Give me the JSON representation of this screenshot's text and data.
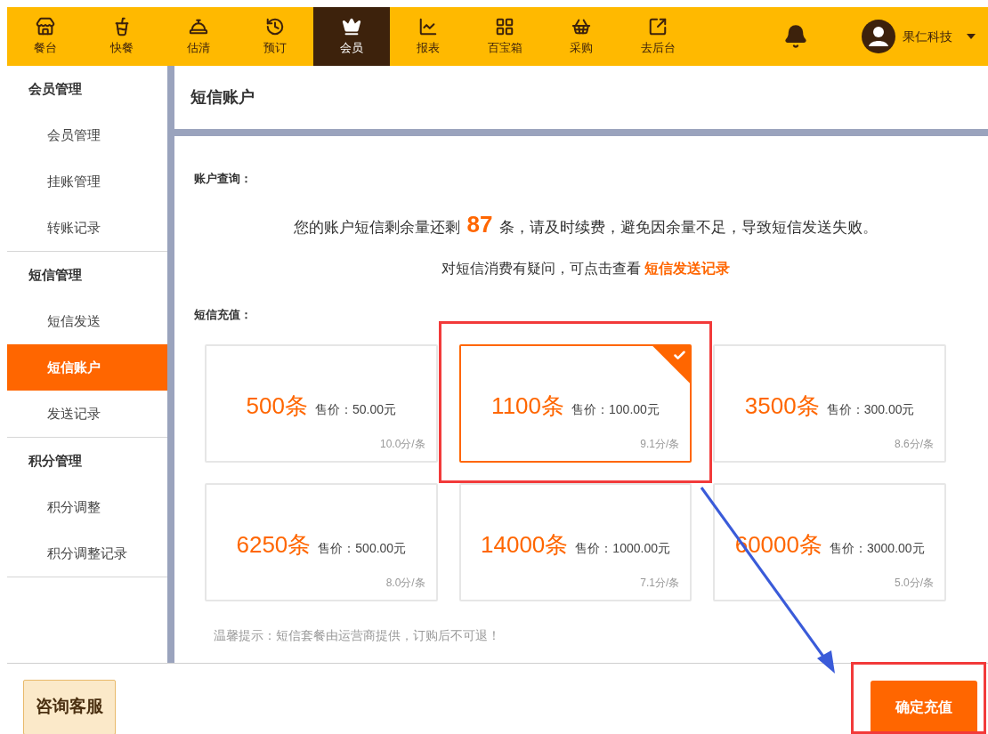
{
  "nav": {
    "items": [
      {
        "label": "餐台",
        "selected": false
      },
      {
        "label": "快餐",
        "selected": false
      },
      {
        "label": "估清",
        "selected": false
      },
      {
        "label": "预订",
        "selected": false
      },
      {
        "label": "会员",
        "selected": true
      },
      {
        "label": "报表",
        "selected": false
      },
      {
        "label": "百宝箱",
        "selected": false
      },
      {
        "label": "采购",
        "selected": false
      },
      {
        "label": "去后台",
        "selected": false
      }
    ],
    "user": "果仁科技"
  },
  "sidebar": {
    "groups": [
      {
        "title": "会员管理",
        "items": [
          {
            "label": "会员管理",
            "selected": false
          },
          {
            "label": "挂账管理",
            "selected": false
          },
          {
            "label": "转账记录",
            "selected": false
          }
        ]
      },
      {
        "title": "短信管理",
        "items": [
          {
            "label": "短信发送",
            "selected": false
          },
          {
            "label": "短信账户",
            "selected": true
          },
          {
            "label": "发送记录",
            "selected": false
          }
        ]
      },
      {
        "title": "积分管理",
        "items": [
          {
            "label": "积分调整",
            "selected": false
          },
          {
            "label": "积分调整记录",
            "selected": false
          }
        ]
      }
    ]
  },
  "page_title": "短信账户",
  "account": {
    "label": "账户查询：",
    "balance_prefix": "您的账户短信剩余量还剩",
    "balance_count": "87",
    "balance_suffix": "条，请及时续费，避免因余量不足，导致短信发送失败。",
    "query_text": "对短信消费有疑问，可点击查看",
    "query_link": "短信发送记录"
  },
  "recharge": {
    "label": "短信充值：",
    "packages": [
      {
        "amount": "500条",
        "price": "售价：50.00元",
        "unit_price": "10.0分/条",
        "selected": false
      },
      {
        "amount": "1100条",
        "price": "售价：100.00元",
        "unit_price": "9.1分/条",
        "selected": true
      },
      {
        "amount": "3500条",
        "price": "售价：300.00元",
        "unit_price": "8.6分/条",
        "selected": false
      },
      {
        "amount": "6250条",
        "price": "售价：500.00元",
        "unit_price": "8.0分/条",
        "selected": false
      },
      {
        "amount": "14000条",
        "price": "售价：1000.00元",
        "unit_price": "7.1分/条",
        "selected": false
      },
      {
        "amount": "60000条",
        "price": "售价：3000.00元",
        "unit_price": "5.0分/条",
        "selected": false
      }
    ],
    "notice": "温馨提示：短信套餐由运营商提供，订购后不可退！"
  },
  "footer": {
    "service_button": "咨询客服",
    "confirm_button": "确定充值"
  }
}
